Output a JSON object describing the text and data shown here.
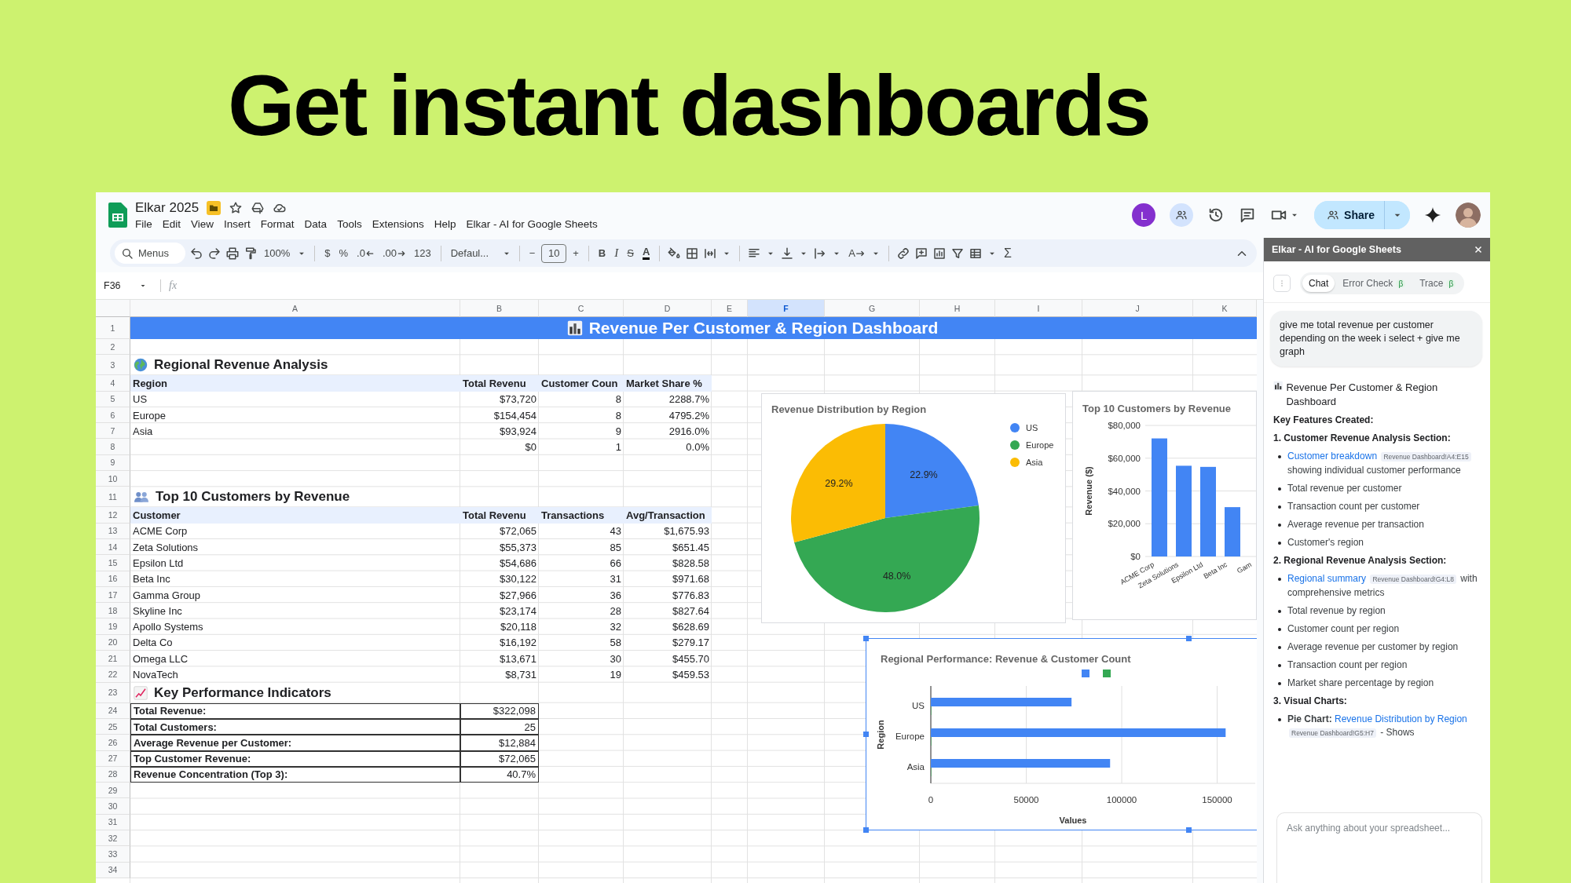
{
  "headline": "Get instant dashboards",
  "app": {
    "title": "Elkar 2025",
    "menus": [
      "File",
      "Edit",
      "View",
      "Insert",
      "Format",
      "Data",
      "Tools",
      "Extensions",
      "Help",
      "Elkar - AI for Google Sheets"
    ],
    "account_initial": "L",
    "share_label": "Share"
  },
  "toolbar": {
    "search": {
      "placeholder": "Menus"
    },
    "zoom": "100%",
    "number_formats": [
      {
        "text": "$",
        "kind": "plain"
      },
      {
        "text": "%",
        "kind": "plain"
      },
      {
        "text": ".0",
        "kind": "decrease"
      },
      {
        "text": ".00",
        "kind": "increase"
      },
      {
        "text": "123",
        "kind": "plain"
      }
    ],
    "font": "Defaul...",
    "size_minus": "−",
    "font_size": "10",
    "size_plus": "+",
    "styles": [
      {
        "text": "B",
        "kind": "bold"
      },
      {
        "text": "I",
        "kind": "italic"
      },
      {
        "text": "S",
        "kind": "strike"
      },
      {
        "text": "A",
        "kind": "color"
      }
    ],
    "rotate_label": "A",
    "sum": "Σ"
  },
  "formula_bar": {
    "cell": "F36",
    "fx": "fx"
  },
  "sheet": {
    "columns": [
      {
        "label": "A",
        "selected": false
      },
      {
        "label": "B",
        "selected": false
      },
      {
        "label": "C",
        "selected": false
      },
      {
        "label": "D",
        "selected": false
      },
      {
        "label": "E",
        "selected": false
      },
      {
        "label": "F",
        "selected": true
      },
      {
        "label": "G",
        "selected": false
      },
      {
        "label": "H",
        "selected": false
      },
      {
        "label": "I",
        "selected": false
      },
      {
        "label": "J",
        "selected": false
      },
      {
        "label": "K",
        "selected": false
      }
    ],
    "rows": [
      {
        "number": "1",
        "kind": "title",
        "title": "Revenue Per Customer & Region Dashboard"
      },
      {
        "number": "2"
      },
      {
        "number": "3",
        "kind": "section",
        "text": "Regional Revenue Analysis"
      },
      {
        "number": "4",
        "kind": "header",
        "cells": [
          "Region",
          "Total Revenu",
          "Customer Coun",
          "Market Share %"
        ]
      },
      {
        "number": "5",
        "kind": "data",
        "cells": [
          "US",
          "$73,720",
          "8",
          "2288.7%"
        ]
      },
      {
        "number": "6",
        "kind": "data",
        "cells": [
          "Europe",
          "$154,454",
          "8",
          "4795.2%"
        ]
      },
      {
        "number": "7",
        "kind": "data",
        "cells": [
          "Asia",
          "$93,924",
          "9",
          "2916.0%"
        ]
      },
      {
        "number": "8",
        "kind": "data",
        "cells": [
          null,
          "$0",
          "1",
          "0.0%"
        ]
      },
      {
        "number": "9"
      },
      {
        "number": "10"
      },
      {
        "number": "11",
        "kind": "section",
        "text": "Top 10 Customers by Revenue"
      },
      {
        "number": "12",
        "kind": "header",
        "cells": [
          "Customer",
          "Total Revenu",
          "Transactions",
          "Avg/Transaction"
        ]
      },
      {
        "number": "13",
        "kind": "data",
        "cells": [
          "ACME Corp",
          "$72,065",
          "43",
          "$1,675.93"
        ]
      },
      {
        "number": "14",
        "kind": "data",
        "cells": [
          "Zeta Solutions",
          "$55,373",
          "85",
          "$651.45"
        ]
      },
      {
        "number": "15",
        "kind": "data",
        "cells": [
          "Epsilon Ltd",
          "$54,686",
          "66",
          "$828.58"
        ]
      },
      {
        "number": "16",
        "kind": "data",
        "cells": [
          "Beta Inc",
          "$30,122",
          "31",
          "$971.68"
        ]
      },
      {
        "number": "17",
        "kind": "data",
        "cells": [
          "Gamma Group",
          "$27,966",
          "36",
          "$776.83"
        ]
      },
      {
        "number": "18",
        "kind": "data",
        "cells": [
          "Skyline Inc",
          "$23,174",
          "28",
          "$827.64"
        ]
      },
      {
        "number": "19",
        "kind": "data",
        "cells": [
          "Apollo Systems",
          "$20,118",
          "32",
          "$628.69"
        ]
      },
      {
        "number": "20",
        "kind": "data",
        "cells": [
          "Delta Co",
          "$16,192",
          "58",
          "$279.17"
        ]
      },
      {
        "number": "21",
        "kind": "data",
        "cells": [
          "Omega LLC",
          "$13,671",
          "30",
          "$455.70"
        ]
      },
      {
        "number": "22",
        "kind": "data",
        "cells": [
          "NovaTech",
          "$8,731",
          "19",
          "$459.53"
        ]
      },
      {
        "number": "23",
        "kind": "section",
        "text": "Key Performance Indicators"
      },
      {
        "number": "24",
        "kind": "kpi",
        "cells": [
          "Total Revenue:",
          "$322,098"
        ]
      },
      {
        "number": "25",
        "kind": "kpi",
        "cells": [
          "Total Customers:",
          "25"
        ]
      },
      {
        "number": "26",
        "kind": "kpi",
        "cells": [
          "Average Revenue per Customer:",
          "$12,884"
        ]
      },
      {
        "number": "27",
        "kind": "kpi",
        "cells": [
          "Top Customer Revenue:",
          "$72,065"
        ]
      },
      {
        "number": "28",
        "kind": "kpi",
        "cells": [
          "Revenue Concentration (Top 3):",
          "40.7%"
        ]
      },
      {
        "number": "29"
      },
      {
        "number": "30"
      },
      {
        "number": "31"
      },
      {
        "number": "32"
      },
      {
        "number": "33"
      },
      {
        "number": "34"
      }
    ],
    "charts": [
      {
        "selected": false,
        "chart_data": {
          "type": "pie",
          "title": "Revenue Distribution by Region",
          "categories": [
            "US",
            "Europe",
            "Asia"
          ],
          "values": [
            22.9,
            48.0,
            29.2
          ],
          "colors": [
            "#4285f4",
            "#34a853",
            "#fbbc04"
          ],
          "legend": "right",
          "value_labels": [
            "22.9%",
            "48.0%",
            "29.2%"
          ]
        }
      },
      {
        "selected": false,
        "chart_data": {
          "type": "bar",
          "title": "Top 10 Customers by Revenue",
          "ylabel": "Revenue ($)",
          "categories": [
            "ACME Corp",
            "Zeta Solutions",
            "Epsilon Ltd",
            "Beta Inc",
            "Gam"
          ],
          "series": [
            {
              "color": "#4285f4",
              "values": [
                72065,
                55373,
                54686,
                30122,
                null
              ]
            }
          ],
          "ylim": [
            0,
            80000
          ],
          "grid": true,
          "yticks": [
            {
              "value": 0,
              "label": "$0"
            },
            {
              "value": 20000,
              "label": "$20,000"
            },
            {
              "value": 40000,
              "label": "$40,000"
            },
            {
              "value": 60000,
              "label": "$60,000"
            },
            {
              "value": 80000,
              "label": "$80,000"
            }
          ]
        }
      },
      {
        "selected": true,
        "chart_data": {
          "type": "bar",
          "orientation": "horizontal",
          "title": "Regional Performance: Revenue & Customer Count",
          "xlabel": "Values",
          "ylabel": "Region",
          "categories": [
            "US",
            "Europe",
            "Asia"
          ],
          "series": [
            {
              "color": "#4285f4",
              "values": [
                73720,
                154454,
                93924
              ]
            },
            {
              "color": "#34a853",
              "values": [
                8,
                8,
                9
              ]
            }
          ],
          "xticks": [
            0,
            50000,
            100000,
            150000
          ],
          "xlim": [
            0,
            170000
          ],
          "grid": true,
          "legend": "top"
        }
      }
    ]
  },
  "assistant": {
    "title": "Elkar - AI for Google Sheets",
    "tabs": [
      {
        "label": "Chat",
        "selected": true
      },
      {
        "label": "Error Check",
        "badge": "β",
        "selected": false
      },
      {
        "label": "Trace",
        "badge": "β",
        "selected": false
      }
    ],
    "user_message": "give me total revenue per customer depending on the week i select + give me graph",
    "reply": {
      "heading": "Revenue Per Customer & Region Dashboard",
      "subheading": "Key Features Created:",
      "sections": [
        {
          "title": "1. Customer Revenue Analysis Section:",
          "items": [
            {
              "link": "Customer breakdown",
              "range": "Revenue Dashboard!A4:E15",
              "text": "showing individual customer performance"
            },
            {
              "text": "Total revenue per customer"
            },
            {
              "text": "Transaction count per customer"
            },
            {
              "text": "Average revenue per transaction"
            },
            {
              "text": "Customer's region"
            }
          ]
        },
        {
          "title": "2. Regional Revenue Analysis Section:",
          "items": [
            {
              "link": "Regional summary",
              "range": "Revenue Dashboard!G4:L8",
              "text": "with comprehensive metrics"
            },
            {
              "text": "Total revenue by region"
            },
            {
              "text": "Customer count per region"
            },
            {
              "text": "Average revenue per customer by region"
            },
            {
              "text": "Transaction count per region"
            },
            {
              "text": "Market share percentage by region"
            }
          ]
        },
        {
          "title": "3. Visual Charts:",
          "items": [
            {
              "label": "Pie Chart:",
              "link": "Revenue Distribution by Region",
              "range": "Revenue Dashboard!G5:H7",
              "text": "- Shows"
            }
          ]
        }
      ]
    },
    "input": {
      "placeholder": "Ask anything about your spreadsheet..."
    }
  }
}
